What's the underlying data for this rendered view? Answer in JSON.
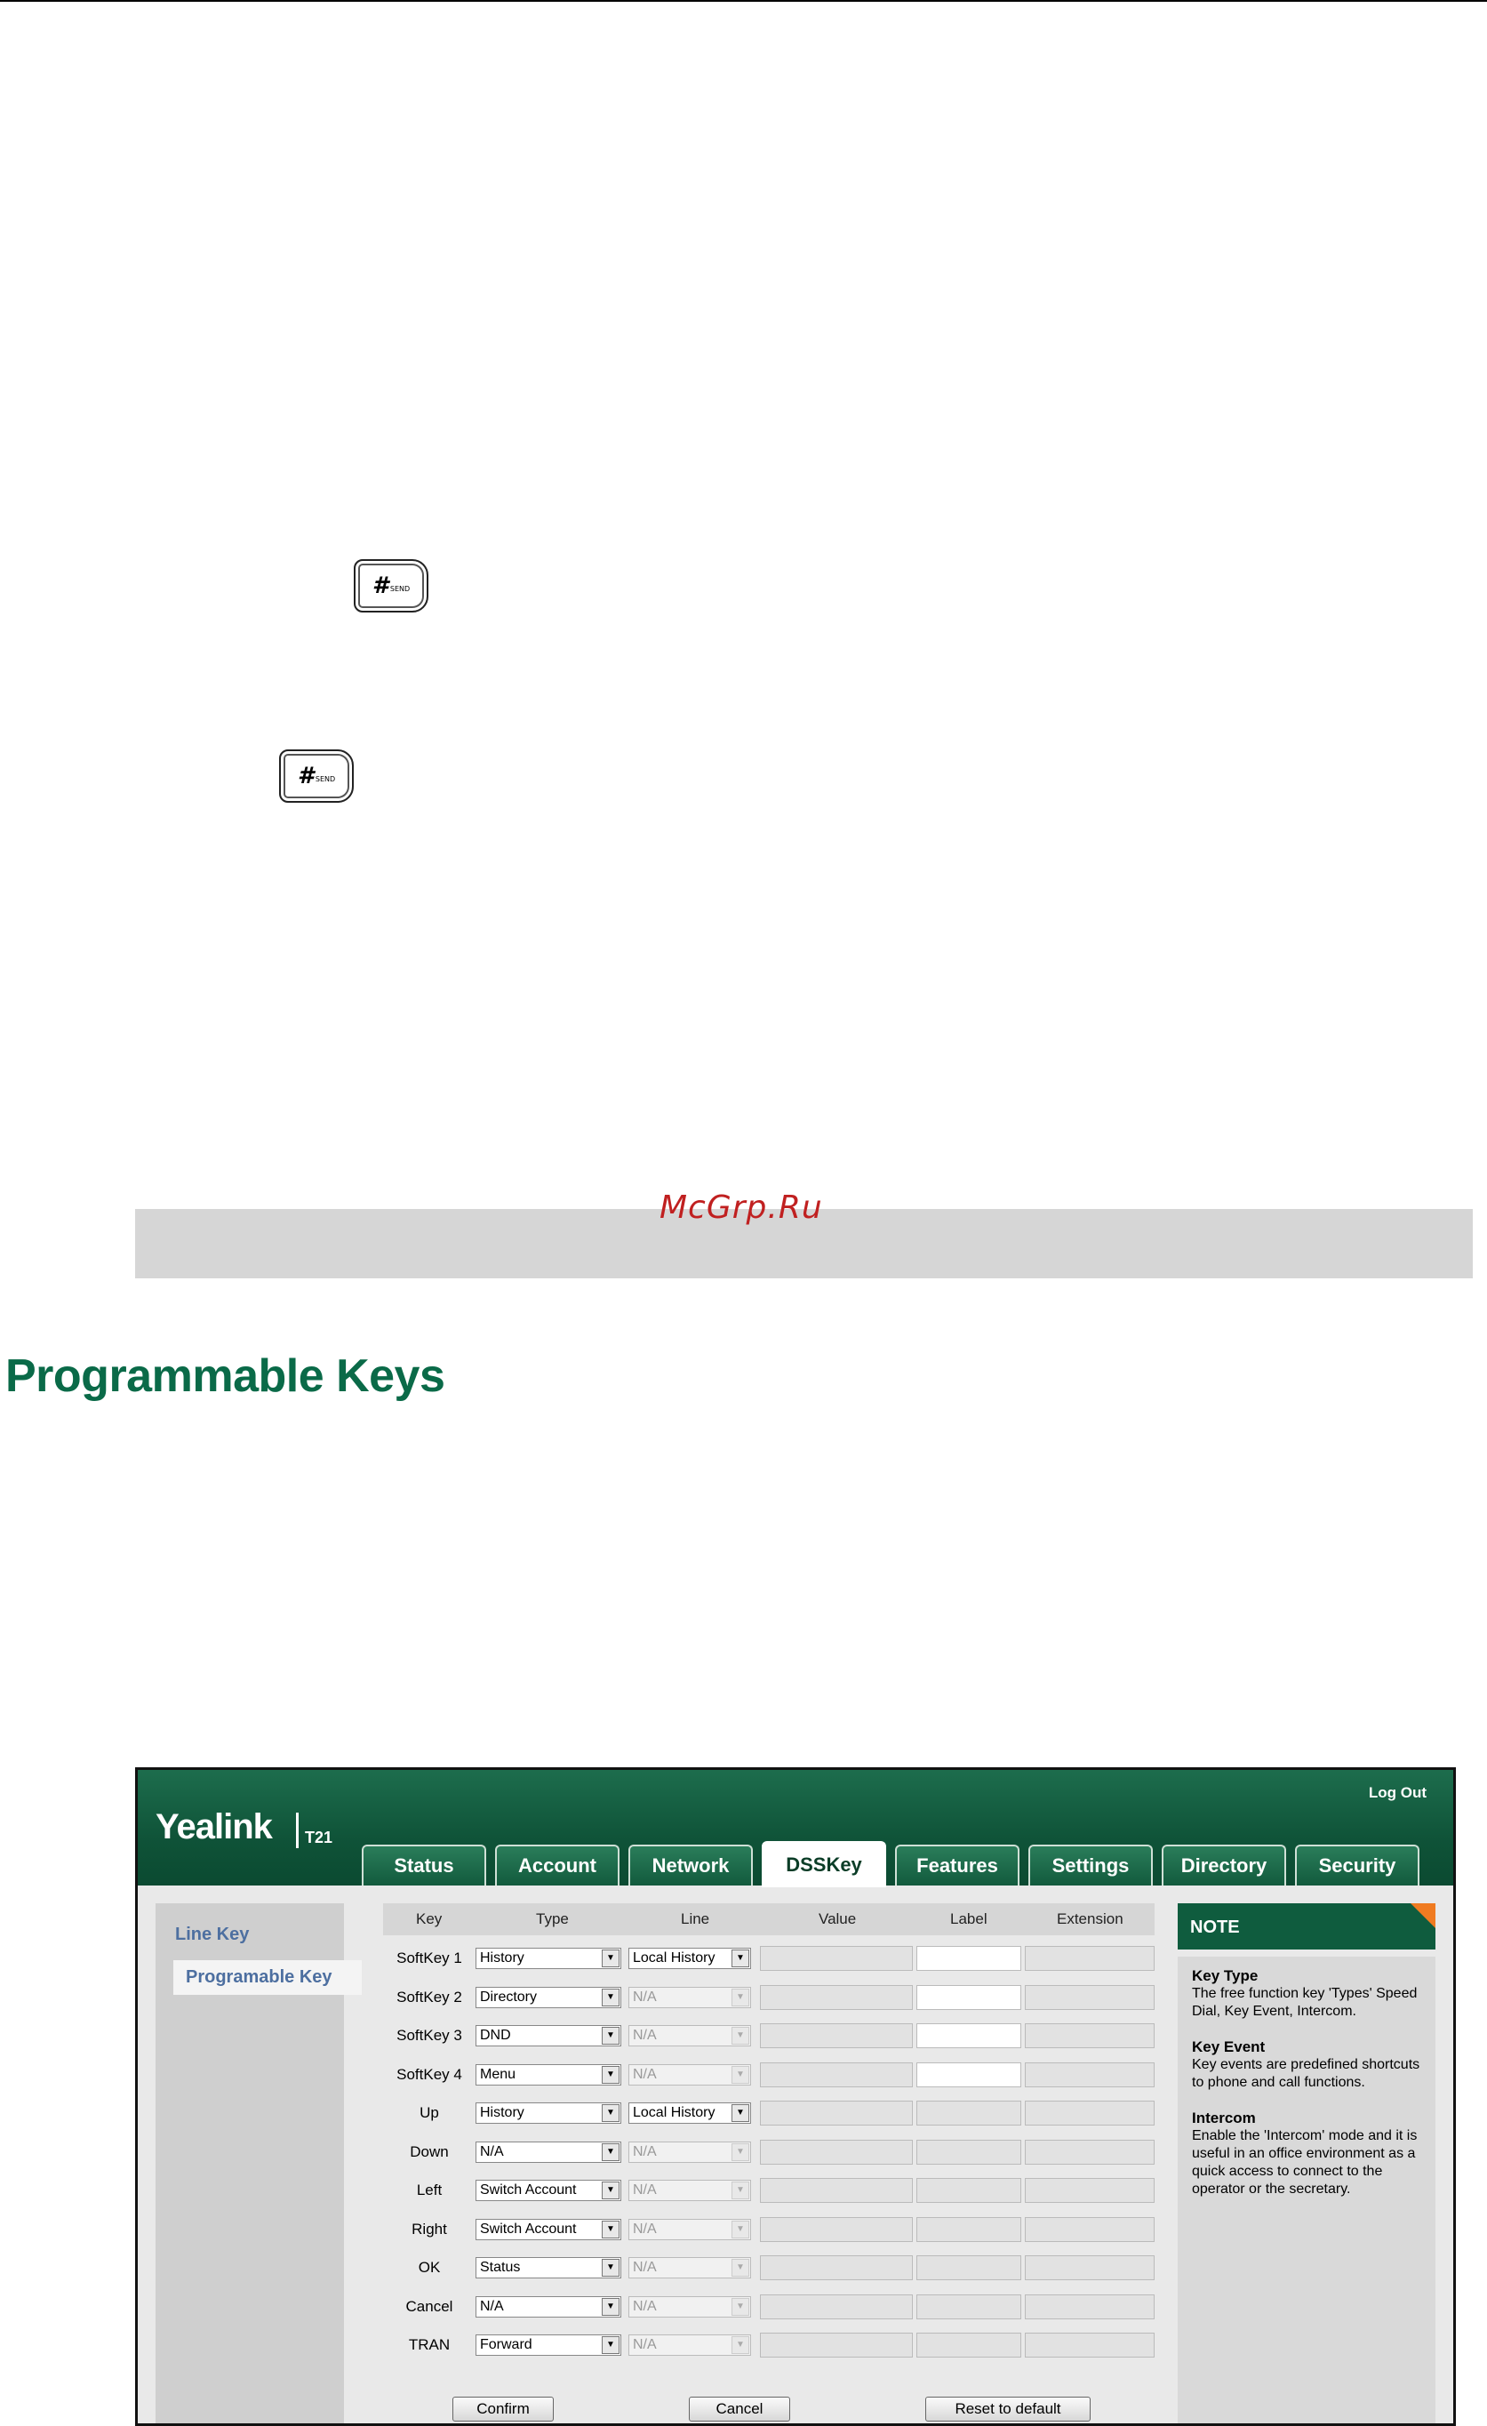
{
  "keycap": {
    "hash": "#",
    "send": "SEND"
  },
  "watermark": "McGrp.Ru",
  "section_title": "Programmable Keys",
  "ui": {
    "brand": "Yealink",
    "model": "T21",
    "logout": "Log Out",
    "tabs": [
      "Status",
      "Account",
      "Network",
      "DSSKey",
      "Features",
      "Settings",
      "Directory",
      "Security"
    ],
    "active_tab": "DSSKey",
    "sidebar": [
      "Line Key",
      "Programable Key"
    ],
    "columns": [
      "Key",
      "Type",
      "Line",
      "Value",
      "Label",
      "Extension"
    ],
    "rows": [
      {
        "key": "SoftKey 1",
        "type": "History",
        "line": "Local History"
      },
      {
        "key": "SoftKey 2",
        "type": "Directory",
        "line": "N/A"
      },
      {
        "key": "SoftKey 3",
        "type": "DND",
        "line": "N/A"
      },
      {
        "key": "SoftKey 4",
        "type": "Menu",
        "line": "N/A"
      },
      {
        "key": "Up",
        "type": "History",
        "line": "Local History"
      },
      {
        "key": "Down",
        "type": "N/A",
        "line": "N/A"
      },
      {
        "key": "Left",
        "type": "Switch Account",
        "line": "N/A"
      },
      {
        "key": "Right",
        "type": "Switch Account",
        "line": "N/A"
      },
      {
        "key": "OK",
        "type": "Status",
        "line": "N/A"
      },
      {
        "key": "Cancel",
        "type": "N/A",
        "line": "N/A"
      },
      {
        "key": "TRAN",
        "type": "Forward",
        "line": "N/A"
      }
    ],
    "buttons": {
      "confirm": "Confirm",
      "cancel": "Cancel",
      "reset": "Reset to default"
    },
    "note": {
      "title": "NOTE",
      "items": [
        {
          "heading": "Key Type",
          "text": "The free function key 'Types' Speed Dial, Key Event, Intercom."
        },
        {
          "heading": "Key Event",
          "text": "Key events are predefined shortcuts to phone and call functions."
        },
        {
          "heading": "Intercom",
          "text": "Enable the 'Intercom' mode and it is useful in an office environment as a quick access to connect to the operator or the secretary."
        }
      ]
    }
  }
}
